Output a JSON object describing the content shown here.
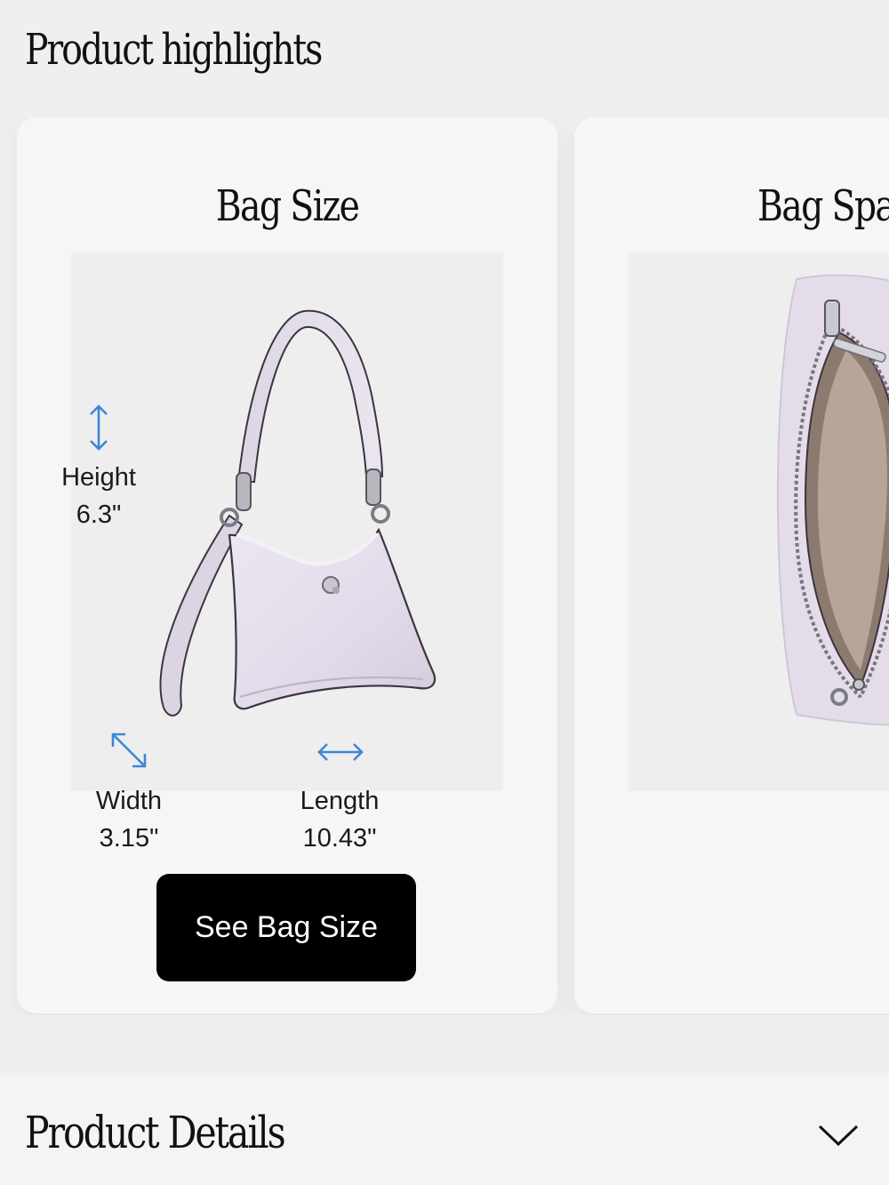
{
  "highlights": {
    "title": "Product highlights",
    "cards": [
      {
        "title": "Bag Size",
        "dimensions": {
          "height": {
            "label": "Height",
            "value": "6.3\""
          },
          "width": {
            "label": "Width",
            "value": "3.15\""
          },
          "length": {
            "label": "Length",
            "value": "10.43\""
          }
        },
        "button_label": "See Bag Size",
        "bag_color": "#e3dce9"
      },
      {
        "title": "Bag Spa"
      }
    ]
  },
  "details": {
    "title": "Product Details",
    "toggle_icon": "chevron-down-icon"
  },
  "colors": {
    "accent": "#3f86d8",
    "button": "#000000",
    "card": "#f6f6f6",
    "page": "#efefef"
  }
}
